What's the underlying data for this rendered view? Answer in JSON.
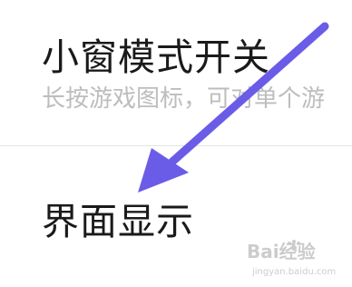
{
  "settings": {
    "items": [
      {
        "title": "小窗模式开关",
        "subtitle": "长按游戏图标，可对单个游"
      },
      {
        "title": "界面显示"
      }
    ]
  },
  "annotation": {
    "arrow_color": "#6b5ce7",
    "arrow_icon": "arrow-down-left-icon"
  },
  "watermark": {
    "brand": "Bai经验",
    "url": "jingyan.baidu.com",
    "icon": "paw-icon"
  }
}
